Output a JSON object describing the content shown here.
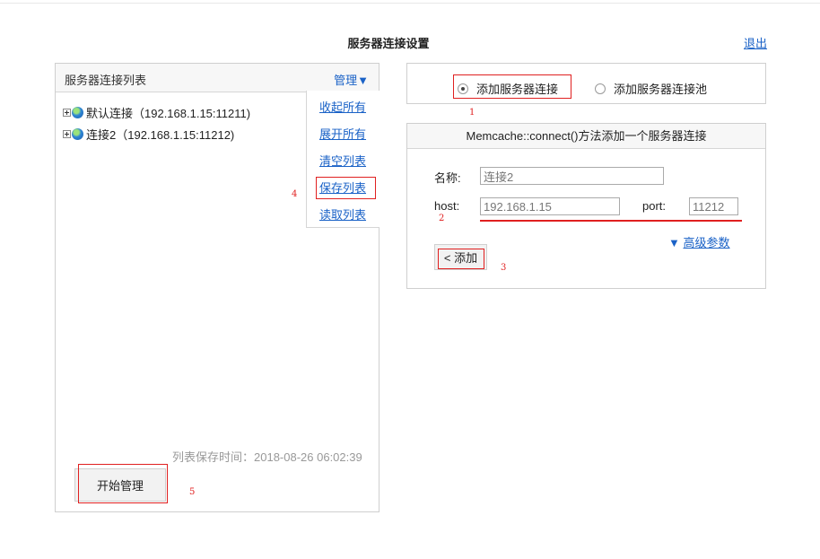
{
  "page": {
    "title": "服务器连接设置",
    "exit_label": "退出"
  },
  "left_panel": {
    "title": "服务器连接列表",
    "manage_label": "管理▼",
    "tree": [
      {
        "label": "默认连接（192.168.1.15:11211)"
      },
      {
        "label": "连接2（192.168.1.15:11212)"
      }
    ],
    "menu": [
      {
        "label": "收起所有"
      },
      {
        "label": "展开所有"
      },
      {
        "label": "清空列表"
      },
      {
        "label": "保存列表"
      },
      {
        "label": "读取列表"
      }
    ],
    "save_time": "列表保存时间：2018-08-26 06:02:39",
    "start_button": "开始管理"
  },
  "radio_panel": {
    "options": [
      {
        "label": "添加服务器连接",
        "checked": true
      },
      {
        "label": "添加服务器连接池",
        "checked": false
      }
    ]
  },
  "form_panel": {
    "header": "Memcache::connect()方法添加一个服务器连接",
    "name_label": "名称:",
    "name_value": "连接2",
    "host_label": "host:",
    "host_value": "192.168.1.15",
    "port_label": "port:",
    "port_value": "11212",
    "advanced_arrow": "▼",
    "advanced_label": "高级参数",
    "add_button": "< 添加"
  },
  "annotations": {
    "marker_color": "#e02020",
    "numbers": [
      "1",
      "2",
      "3",
      "4",
      "5"
    ]
  }
}
